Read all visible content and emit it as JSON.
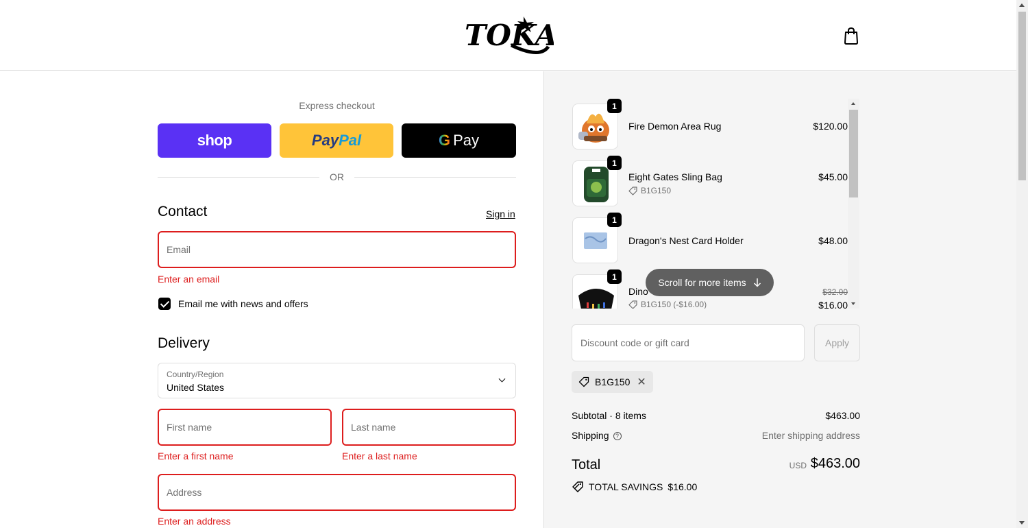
{
  "brand": {
    "logo_text": "TOKA"
  },
  "express": {
    "title": "Express checkout",
    "shop": "shop",
    "paypal_1": "Pay",
    "paypal_2": "Pal",
    "gpay_g": "G",
    "gpay": "Pay",
    "or": "OR"
  },
  "contact": {
    "title": "Contact",
    "signin": "Sign in",
    "email_placeholder": "Email",
    "email_error": "Enter an email",
    "newsletter_label": "Email me with news and offers",
    "newsletter_checked": true
  },
  "delivery": {
    "title": "Delivery",
    "country_label": "Country/Region",
    "country_value": "United States",
    "first_name_placeholder": "First name",
    "first_name_error": "Enter a first name",
    "last_name_placeholder": "Last name",
    "last_name_error": "Enter a last name",
    "address_placeholder": "Address",
    "address_error": "Enter an address"
  },
  "cart": {
    "items": [
      {
        "name": "Fire Demon Area Rug",
        "qty": "1",
        "price": "$120.00"
      },
      {
        "name": "Eight Gates Sling Bag",
        "qty": "1",
        "price": "$45.00",
        "discount": "B1G150"
      },
      {
        "name": "Dragon's Nest Card Holder",
        "qty": "1",
        "price": "$48.00"
      },
      {
        "name": "Dino",
        "qty": "1",
        "original_price": "$32.00",
        "price": "$16.00",
        "discount": "B1G150 (-$16.00)"
      }
    ],
    "scroll_hint": "Scroll for more items"
  },
  "discount": {
    "placeholder": "Discount code or gift card",
    "apply": "Apply",
    "applied_code": "B1G150"
  },
  "summary": {
    "subtotal_label": "Subtotal · 8 items",
    "subtotal_value": "$463.00",
    "shipping_label": "Shipping",
    "shipping_value": "Enter shipping address",
    "total_label": "Total",
    "currency": "USD",
    "total_value": "$463.00",
    "savings_label": "TOTAL SAVINGS",
    "savings_value": "$16.00"
  }
}
